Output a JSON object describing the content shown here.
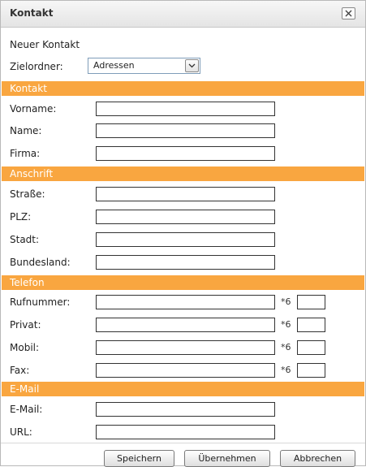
{
  "dialog": {
    "title": "Kontakt"
  },
  "header": {
    "new_contact": "Neuer Kontakt",
    "folder_label": "Zielordner:",
    "folder_value": "Adressen"
  },
  "sections": {
    "kontakt": {
      "title": "Kontakt",
      "fields": [
        "Vorname:",
        "Name:",
        "Firma:"
      ]
    },
    "anschrift": {
      "title": "Anschrift",
      "fields": [
        "Straße:",
        "PLZ:",
        "Stadt:",
        "Bundesland:"
      ]
    },
    "telefon": {
      "title": "Telefon",
      "fields": [
        "Rufnummer:",
        "Privat:",
        "Mobil:",
        "Fax:"
      ],
      "ext_prefix": "*6"
    },
    "email": {
      "title": "E-Mail",
      "fields": [
        "E-Mail:",
        "URL:"
      ]
    }
  },
  "buttons": {
    "save": "Speichern",
    "apply": "Übernehmen",
    "cancel": "Abbrechen"
  },
  "colors": {
    "section_header": "#f9a640",
    "section_text": "#ffffff"
  },
  "icons": {
    "close": "close-icon",
    "dropdown": "chevron-down-icon"
  }
}
